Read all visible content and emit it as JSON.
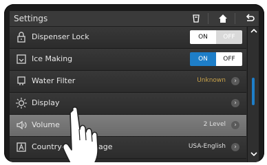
{
  "header": {
    "title": "Settings",
    "icons": [
      "filter-icon",
      "home-icon",
      "back-icon"
    ]
  },
  "rows": [
    {
      "label": "Dispenser Lock",
      "icon": "lock-icon",
      "toggle": {
        "on": "ON",
        "off": "OFF",
        "active": "on"
      }
    },
    {
      "label": "Ice Making",
      "icon": "ice-icon",
      "toggle": {
        "on": "ON",
        "off": "OFF",
        "active": "on"
      }
    },
    {
      "label": "Water Filter",
      "icon": "water-filter-icon",
      "value": "Unknown"
    },
    {
      "label": "Display",
      "icon": "display-icon"
    },
    {
      "label": "Volume",
      "icon": "volume-icon",
      "value": "2 Level"
    },
    {
      "label": "Country-Language",
      "visible_label_part1": "Country-",
      "visible_label_part2": "uage",
      "icon": "language-icon",
      "value": "USA-English"
    }
  ],
  "colors": {
    "accent": "#1e7ec8",
    "unknown": "#c8a24a"
  },
  "scroll": {
    "up": "^",
    "down": "v"
  }
}
